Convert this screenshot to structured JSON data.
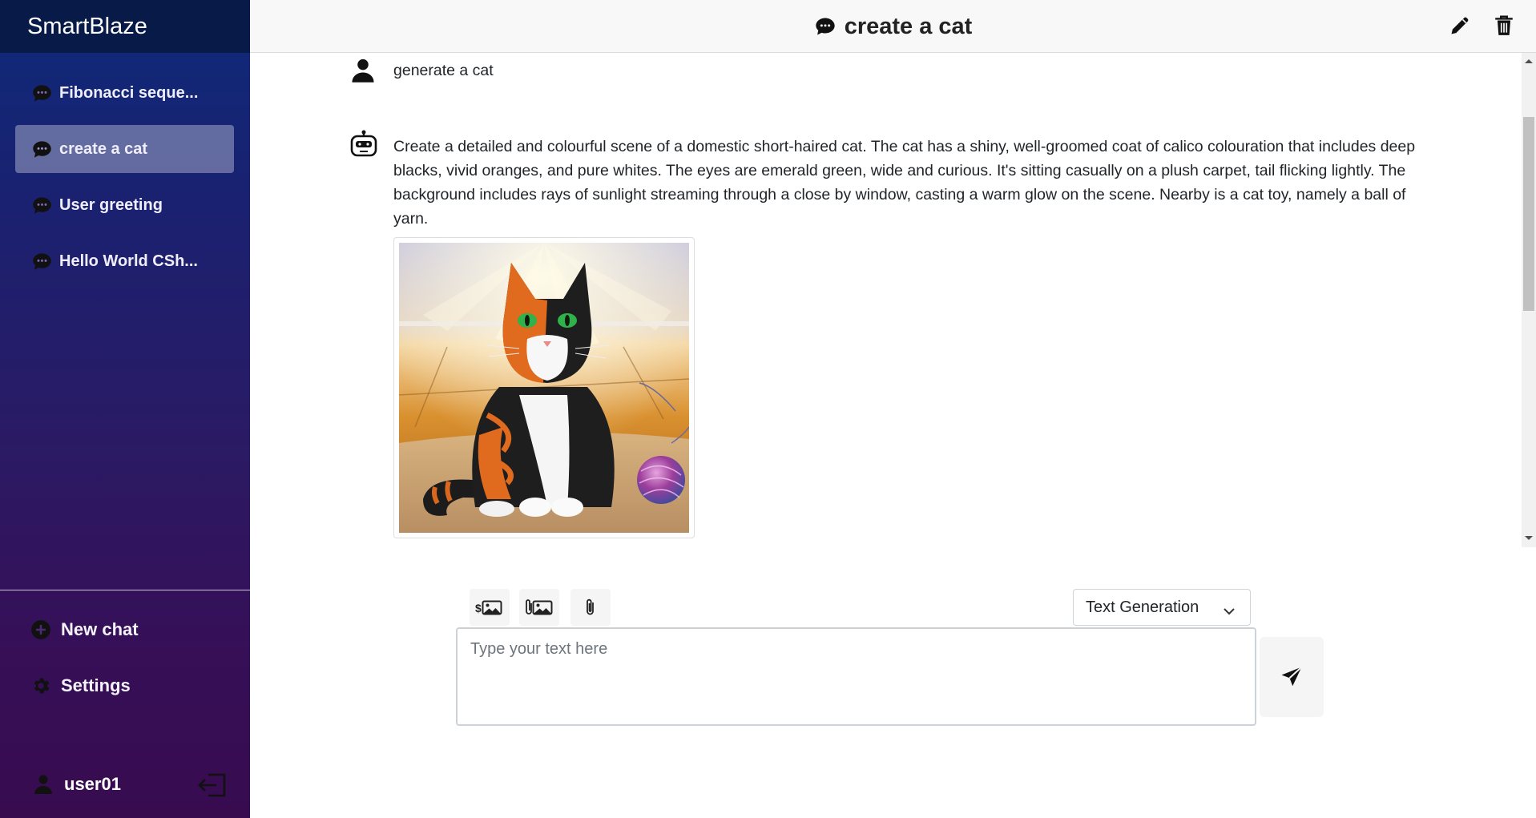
{
  "app": {
    "name": "SmartBlaze"
  },
  "sidebar": {
    "chats": [
      {
        "label": "Fibonacci seque...",
        "icon": "chat-bubble-icon",
        "active": false
      },
      {
        "label": "create a cat",
        "icon": "chat-bubble-icon",
        "active": true
      },
      {
        "label": "User greeting",
        "icon": "chat-bubble-icon",
        "active": false
      },
      {
        "label": "Hello World CSh...",
        "icon": "chat-bubble-icon",
        "active": false
      }
    ],
    "new_chat_label": "New chat",
    "settings_label": "Settings",
    "user_name": "user01"
  },
  "header": {
    "title": "create a cat",
    "icons": [
      "chat-bubble-icon",
      "pencil-icon",
      "trash-icon"
    ]
  },
  "messages": [
    {
      "role": "user",
      "icon": "user-icon",
      "text": "generate a cat"
    },
    {
      "role": "assistant",
      "icon": "robot-icon",
      "text": "Create a detailed and colourful scene of a domestic short-haired cat. The cat has a shiny, well-groomed coat of calico colouration that includes deep blacks, vivid oranges, and pure whites. The eyes are emerald green, wide and curious. It's sitting casually on a plush carpet, tail flicking lightly. The background includes rays of sunlight streaming through a close by window, casting a warm glow on the scene. Nearby is a cat toy, namely a ball of yarn.",
      "has_image": true
    }
  ],
  "composer": {
    "tools": [
      "dollar-image-icon",
      "attach-image-icon",
      "paperclip-icon"
    ],
    "mode": "Text Generation",
    "placeholder": "Type your text here",
    "value": ""
  },
  "colors": {
    "sidebar_top": "#0e2a7a",
    "sidebar_bottom": "#380b4f",
    "brand_bar": "#071a48",
    "header_bg": "#f8f8f8"
  }
}
